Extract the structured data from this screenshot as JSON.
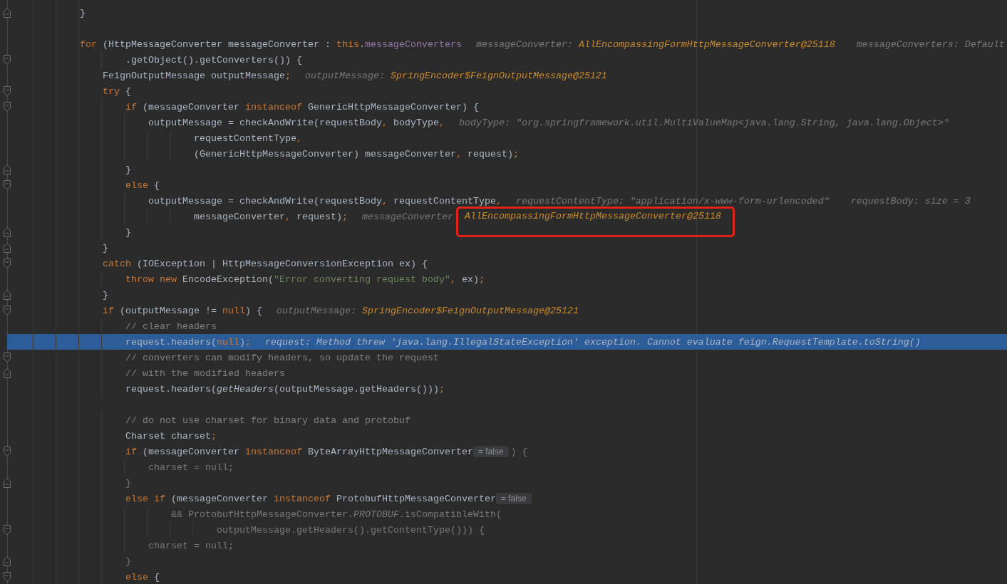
{
  "editor": {
    "lines": [
      {
        "current": false,
        "fold": {
          "kind": "end"
        },
        "code": [
          {
            "kind": "code",
            "tokens": [
              {
                "kind": "plain",
                "text": "        }"
              }
            ]
          }
        ]
      },
      {
        "current": false
      },
      {
        "current": false,
        "code": [
          {
            "kind": "code",
            "tokens": [
              {
                "kind": "keyword",
                "text": "        for"
              },
              {
                "kind": "plain",
                "text": " (HttpMessageConverter messageConverter : "
              },
              {
                "kind": "keyword",
                "text": "this"
              },
              {
                "kind": "plain",
                "text": "."
              },
              {
                "kind": "field",
                "text": "messageConverters"
              }
            ]
          }
        ],
        "hints": [
          {
            "name": "messageConverter:",
            "value": "AllEncompassingFormHttpMessageConverter@25118",
            "kind": "object",
            "highlighted": false
          },
          {
            "name": "messageConverters:",
            "value": "Default",
            "kind": "text",
            "highlighted": false
          }
        ]
      },
      {
        "current": false,
        "fold": {
          "kind": "start"
        },
        "code": [
          {
            "kind": "code",
            "tokens": [
              {
                "kind": "plain",
                "text": "                .getObject().getConverters()) {"
              }
            ]
          }
        ]
      },
      {
        "current": false,
        "code": [
          {
            "kind": "code",
            "tokens": [
              {
                "kind": "plain",
                "text": "            FeignOutputMessage outputMessage"
              },
              {
                "kind": "punct",
                "text": ";"
              }
            ]
          }
        ],
        "hints": [
          {
            "name": "outputMessage:",
            "value": "SpringEncoder$FeignOutputMessage@25121",
            "kind": "object",
            "highlighted": false
          }
        ]
      },
      {
        "current": false,
        "fold": {
          "kind": "start"
        },
        "code": [
          {
            "kind": "code",
            "tokens": [
              {
                "kind": "keyword",
                "text": "            try"
              },
              {
                "kind": "plain",
                "text": " {"
              }
            ]
          }
        ]
      },
      {
        "current": false,
        "fold": {
          "kind": "start"
        },
        "code": [
          {
            "kind": "code",
            "tokens": [
              {
                "kind": "keyword",
                "text": "                if"
              },
              {
                "kind": "plain",
                "text": " (messageConverter "
              },
              {
                "kind": "keyword",
                "text": "instanceof"
              },
              {
                "kind": "plain",
                "text": " GenericHttpMessageConverter) {"
              }
            ]
          }
        ]
      },
      {
        "current": false,
        "code": [
          {
            "kind": "code",
            "tokens": [
              {
                "kind": "plain",
                "text": "                    outputMessage = checkAndWrite(requestBody"
              },
              {
                "kind": "punct",
                "text": ","
              },
              {
                "kind": "plain",
                "text": " bodyType"
              },
              {
                "kind": "punct",
                "text": ","
              }
            ]
          }
        ],
        "hints": [
          {
            "name": "bodyType:",
            "value": "\"org.springframework.util.MultiValueMap<java.lang.String, java.lang.Object>\"",
            "kind": "text",
            "highlighted": false
          }
        ]
      },
      {
        "current": false,
        "code": [
          {
            "kind": "code",
            "tokens": [
              {
                "kind": "plain",
                "text": "                            requestContentType"
              },
              {
                "kind": "punct",
                "text": ","
              }
            ]
          }
        ]
      },
      {
        "current": false,
        "code": [
          {
            "kind": "code",
            "tokens": [
              {
                "kind": "plain",
                "text": "                            (GenericHttpMessageConverter) messageConverter"
              },
              {
                "kind": "punct",
                "text": ","
              },
              {
                "kind": "plain",
                "text": " request)"
              },
              {
                "kind": "punct",
                "text": ";"
              }
            ]
          }
        ]
      },
      {
        "current": false,
        "fold": {
          "kind": "end"
        },
        "code": [
          {
            "kind": "code",
            "tokens": [
              {
                "kind": "plain",
                "text": "                }"
              }
            ]
          }
        ]
      },
      {
        "current": false,
        "fold": {
          "kind": "start"
        },
        "code": [
          {
            "kind": "code",
            "tokens": [
              {
                "kind": "keyword",
                "text": "                else"
              },
              {
                "kind": "plain",
                "text": " {"
              }
            ]
          }
        ]
      },
      {
        "current": false,
        "code": [
          {
            "kind": "code",
            "tokens": [
              {
                "kind": "plain",
                "text": "                    outputMessage = checkAndWrite(requestBody"
              },
              {
                "kind": "punct",
                "text": ","
              },
              {
                "kind": "plain",
                "text": " requestContentType"
              },
              {
                "kind": "punct",
                "text": ","
              }
            ]
          }
        ],
        "hints": [
          {
            "name": "requestContentType:",
            "value": "\"application/x-www-form-urlencoded\"",
            "kind": "text",
            "highlighted": false
          },
          {
            "name": "requestBody:",
            "value": "size = 3",
            "kind": "text",
            "highlighted": false
          }
        ]
      },
      {
        "current": false,
        "code": [
          {
            "kind": "code",
            "tokens": [
              {
                "kind": "plain",
                "text": "                            messageConverter"
              },
              {
                "kind": "punct",
                "text": ","
              },
              {
                "kind": "plain",
                "text": " request)"
              },
              {
                "kind": "punct",
                "text": ";"
              }
            ]
          }
        ],
        "hints": [
          {
            "name": "messageConverter",
            "value": "AllEncompassingFormHttpMessageConverter@25118",
            "kind": "object",
            "highlighted": true
          }
        ]
      },
      {
        "current": false,
        "fold": {
          "kind": "end"
        },
        "code": [
          {
            "kind": "code",
            "tokens": [
              {
                "kind": "plain",
                "text": "                }"
              }
            ]
          }
        ]
      },
      {
        "current": false,
        "fold": {
          "kind": "end"
        },
        "code": [
          {
            "kind": "code",
            "tokens": [
              {
                "kind": "plain",
                "text": "            }"
              }
            ]
          }
        ]
      },
      {
        "current": false,
        "fold": {
          "kind": "start"
        },
        "code": [
          {
            "kind": "code",
            "tokens": [
              {
                "kind": "keyword",
                "text": "            catch"
              },
              {
                "kind": "plain",
                "text": " (IOException | HttpMessageConversionException ex) {"
              }
            ]
          }
        ]
      },
      {
        "current": false,
        "code": [
          {
            "kind": "code",
            "tokens": [
              {
                "kind": "keyword",
                "text": "                throw new"
              },
              {
                "kind": "plain",
                "text": " EncodeException("
              },
              {
                "kind": "string",
                "text": "\"Error converting request body\""
              },
              {
                "kind": "punct",
                "text": ","
              },
              {
                "kind": "plain",
                "text": " ex)"
              },
              {
                "kind": "punct",
                "text": ";"
              }
            ]
          }
        ]
      },
      {
        "current": false,
        "fold": {
          "kind": "end"
        },
        "code": [
          {
            "kind": "code",
            "tokens": [
              {
                "kind": "plain",
                "text": "            }"
              }
            ]
          }
        ]
      },
      {
        "current": false,
        "fold": {
          "kind": "start"
        },
        "code": [
          {
            "kind": "code",
            "tokens": [
              {
                "kind": "keyword",
                "text": "            if"
              },
              {
                "kind": "plain",
                "text": " (outputMessage != "
              },
              {
                "kind": "keyword",
                "text": "null"
              },
              {
                "kind": "plain",
                "text": ") {"
              }
            ]
          }
        ],
        "hints": [
          {
            "name": "outputMessage:",
            "value": "SpringEncoder$FeignOutputMessage@25121",
            "kind": "object",
            "highlighted": false
          }
        ]
      },
      {
        "current": false,
        "code": [
          {
            "kind": "code",
            "tokens": [
              {
                "kind": "comment",
                "text": "                // clear headers"
              }
            ]
          }
        ]
      },
      {
        "current": true,
        "code": [
          {
            "kind": "code",
            "tokens": [
              {
                "kind": "plain",
                "text": "                request.headers("
              },
              {
                "kind": "keyword",
                "text": "null"
              },
              {
                "kind": "plain",
                "text": ")"
              },
              {
                "kind": "punct",
                "text": ";"
              }
            ]
          }
        ],
        "hints": [
          {
            "name": "request:",
            "value": "Method threw 'java.lang.IllegalStateException' exception. Cannot evaluate feign.RequestTemplate.toString()",
            "kind": "text",
            "highlighted": false
          }
        ]
      },
      {
        "current": false,
        "fold": {
          "kind": "start"
        },
        "code": [
          {
            "kind": "code",
            "tokens": [
              {
                "kind": "comment",
                "text": "                // converters can modify headers, so update the request"
              }
            ]
          }
        ]
      },
      {
        "current": false,
        "fold": {
          "kind": "end"
        },
        "code": [
          {
            "kind": "code",
            "tokens": [
              {
                "kind": "comment",
                "text": "                // with the modified headers"
              }
            ]
          }
        ]
      },
      {
        "current": false,
        "code": [
          {
            "kind": "code",
            "tokens": [
              {
                "kind": "plain",
                "text": "                request.headers("
              },
              {
                "kind": "call",
                "text": "getHeaders"
              },
              {
                "kind": "plain",
                "text": "(outputMessage.getHeaders()))"
              },
              {
                "kind": "punct",
                "text": ";"
              }
            ]
          }
        ]
      },
      {
        "current": false
      },
      {
        "current": false,
        "code": [
          {
            "kind": "code",
            "tokens": [
              {
                "kind": "comment",
                "text": "                // do not use charset for binary data and protobuf"
              }
            ]
          }
        ]
      },
      {
        "current": false,
        "code": [
          {
            "kind": "code",
            "tokens": [
              {
                "kind": "plain",
                "text": "                Charset charset"
              },
              {
                "kind": "punct",
                "text": ";"
              }
            ]
          }
        ]
      },
      {
        "current": false,
        "fold": {
          "kind": "start"
        },
        "code": [
          {
            "kind": "code",
            "tokens": [
              {
                "kind": "keyword",
                "text": "                if"
              },
              {
                "kind": "plain",
                "text": " (messageConverter "
              },
              {
                "kind": "keyword",
                "text": "instanceof"
              },
              {
                "kind": "plain",
                "text": " ByteArrayHttpMessageConverter"
              }
            ]
          },
          {
            "kind": "inlay",
            "text": "= false"
          },
          {
            "kind": "code",
            "tokens": [
              {
                "kind": "dim",
                "text": ") {"
              }
            ]
          }
        ]
      },
      {
        "current": false,
        "code": [
          {
            "kind": "code",
            "tokens": [
              {
                "kind": "dim",
                "text": "                    charset = null;"
              }
            ]
          }
        ]
      },
      {
        "current": false,
        "fold": {
          "kind": "end"
        },
        "code": [
          {
            "kind": "code",
            "tokens": [
              {
                "kind": "dim",
                "text": "                }"
              }
            ]
          }
        ]
      },
      {
        "current": false,
        "code": [
          {
            "kind": "code",
            "tokens": [
              {
                "kind": "keyword",
                "text": "                else if"
              },
              {
                "kind": "plain",
                "text": " (messageConverter "
              },
              {
                "kind": "keyword",
                "text": "instanceof"
              },
              {
                "kind": "plain",
                "text": " ProtobufHttpMessageConverter"
              }
            ]
          },
          {
            "kind": "inlay",
            "text": "= false"
          }
        ]
      },
      {
        "current": false,
        "code": [
          {
            "kind": "code",
            "tokens": [
              {
                "kind": "dim",
                "text": "                        && ProtobufHttpMessageConverter."
              },
              {
                "kind": "dimconst",
                "text": "PROTOBUF"
              },
              {
                "kind": "dim",
                "text": ".isCompatibleWith("
              }
            ]
          }
        ]
      },
      {
        "current": false,
        "fold": {
          "kind": "start"
        },
        "code": [
          {
            "kind": "code",
            "tokens": [
              {
                "kind": "dim",
                "text": "                                outputMessage.getHeaders().getContentType())) {"
              }
            ]
          }
        ]
      },
      {
        "current": false,
        "code": [
          {
            "kind": "code",
            "tokens": [
              {
                "kind": "dim",
                "text": "                    charset = null;"
              }
            ]
          }
        ]
      },
      {
        "current": false,
        "fold": {
          "kind": "end"
        },
        "code": [
          {
            "kind": "code",
            "tokens": [
              {
                "kind": "dim",
                "text": "                }"
              }
            ]
          }
        ]
      },
      {
        "current": false,
        "fold": {
          "kind": "start"
        },
        "code": [
          {
            "kind": "code",
            "tokens": [
              {
                "kind": "keyword",
                "text": "                else"
              },
              {
                "kind": "plain",
                "text": " {"
              }
            ]
          }
        ]
      }
    ]
  }
}
